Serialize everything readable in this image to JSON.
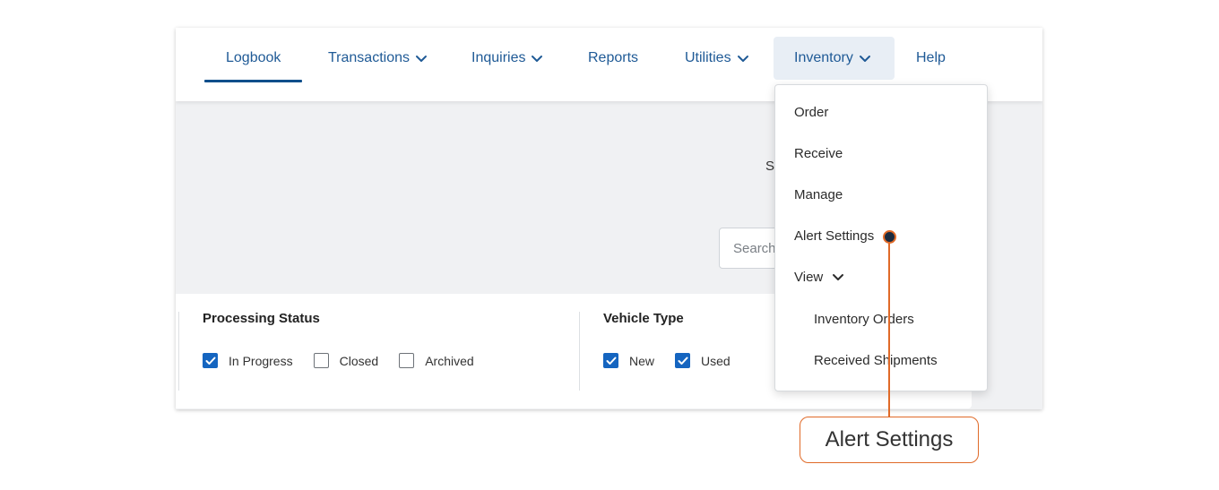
{
  "nav": {
    "items": [
      {
        "label": "Logbook",
        "has_dropdown": false,
        "active": true
      },
      {
        "label": "Transactions",
        "has_dropdown": true
      },
      {
        "label": "Inquiries",
        "has_dropdown": true
      },
      {
        "label": "Reports",
        "has_dropdown": false
      },
      {
        "label": "Utilities",
        "has_dropdown": true
      },
      {
        "label": "Inventory",
        "has_dropdown": true,
        "open": true
      },
      {
        "label": "Help",
        "has_dropdown": false
      }
    ]
  },
  "content": {
    "partial_text": "S",
    "search_placeholder": "Search"
  },
  "filters": {
    "processing_status": {
      "title": "Processing Status",
      "options": [
        {
          "label": "In Progress",
          "checked": true
        },
        {
          "label": "Closed",
          "checked": false
        },
        {
          "label": "Archived",
          "checked": false
        }
      ]
    },
    "vehicle_type": {
      "title": "Vehicle Type",
      "options": [
        {
          "label": "New",
          "checked": true
        },
        {
          "label": "Used",
          "checked": true
        }
      ]
    }
  },
  "inventory_menu": {
    "items": [
      "Order",
      "Receive",
      "Manage",
      "Alert Settings"
    ],
    "view_label": "View",
    "view_subitems": [
      "Inventory Orders",
      "Received Shipments"
    ]
  },
  "callout": {
    "label": "Alert Settings"
  },
  "colors": {
    "nav_text": "#1f5a96",
    "active_underline": "#0d4f8b",
    "checkbox_checked": "#1565c0",
    "callout_accent": "#e06a28"
  }
}
